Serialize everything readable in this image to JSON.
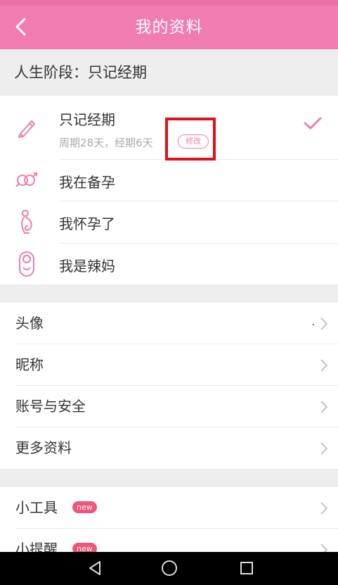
{
  "header": {
    "title": "我的资料"
  },
  "life_stage": {
    "heading": "人生阶段：只记经期"
  },
  "stages": [
    {
      "label": "只记经期",
      "sub": "周期28天，经期6天",
      "edit_label": "修改",
      "selected": true,
      "icon": "pencil-icon"
    },
    {
      "label": "我在备孕",
      "icon": "gender-rings-icon"
    },
    {
      "label": "我怀孕了",
      "icon": "pregnant-icon"
    },
    {
      "label": "我是辣妈",
      "icon": "baby-icon"
    }
  ],
  "menu": [
    {
      "label": "头像"
    },
    {
      "label": "昵称"
    },
    {
      "label": "账号与安全"
    },
    {
      "label": "更多资料"
    }
  ],
  "tools": [
    {
      "label": "小工具",
      "badge": "new"
    },
    {
      "label": "小提醒",
      "badge": "new"
    }
  ],
  "colors": {
    "brand": "#f07cb1",
    "badge": "#f0567a",
    "highlight": "#e0101c"
  }
}
